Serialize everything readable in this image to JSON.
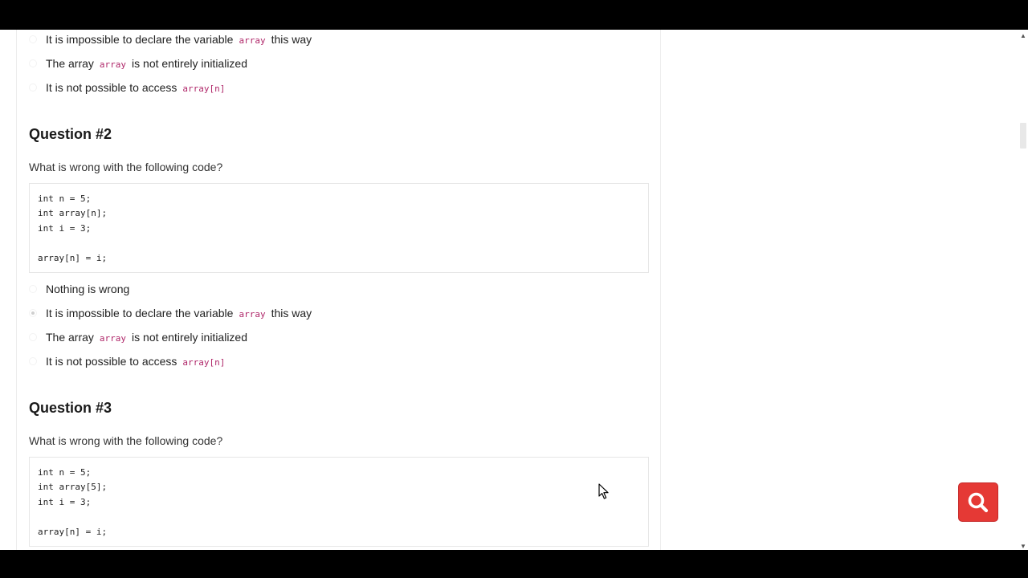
{
  "question1_tail": {
    "options": [
      {
        "text_before": "It is impossible to declare the variable",
        "code": "array",
        "text_after": "this way",
        "checked": false
      },
      {
        "text_before": "The array",
        "code": "array",
        "text_after": "is not entirely initialized",
        "checked": false
      },
      {
        "text_before": "It is not possible to access",
        "code": "array[n]",
        "text_after": "",
        "checked": false
      }
    ]
  },
  "question2": {
    "title": "Question #2",
    "prompt": "What is wrong with the following code?",
    "code_lines": [
      "int n = 5;",
      "int array[n];",
      "int i = 3;",
      "",
      "array[n] = i;"
    ],
    "options": [
      {
        "text_before": "Nothing is wrong",
        "code": "",
        "text_after": "",
        "checked": false
      },
      {
        "text_before": "It is impossible to declare the variable",
        "code": "array",
        "text_after": "this way",
        "checked": true
      },
      {
        "text_before": "The array",
        "code": "array",
        "text_after": "is not entirely initialized",
        "checked": false
      },
      {
        "text_before": "It is not possible to access",
        "code": "array[n]",
        "text_after": "",
        "checked": false
      }
    ]
  },
  "question3": {
    "title": "Question #3",
    "prompt": "What is wrong with the following code?",
    "code_lines": [
      "int n = 5;",
      "int array[5];",
      "int i = 3;",
      "",
      "array[n] = i;"
    ]
  },
  "colors": {
    "fab_background": "#e53935",
    "inline_code": "#b0286a"
  },
  "icons": {
    "fab": "search-icon",
    "scroll_up": "arrow-up-icon",
    "scroll_down": "arrow-down-icon",
    "pointer": "mouse-cursor-icon"
  }
}
